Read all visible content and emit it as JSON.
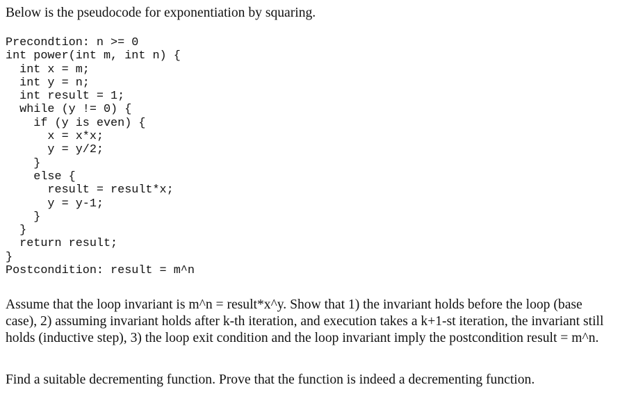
{
  "intro": "Below is the pseudocode for exponentiation by squaring.",
  "code_lines": [
    "Precondtion: n >= 0",
    "int power(int m, int n) {",
    "  int x = m;",
    "  int y = n;",
    "  int result = 1;",
    "  while (y != 0) {",
    "    if (y is even) {",
    "      x = x*x;",
    "      y = y/2;",
    "    }",
    "    else {",
    "      result = result*x;",
    "      y = y-1;",
    "    }",
    "  }",
    "  return result;",
    "}",
    "Postcondition: result = m^n"
  ],
  "assume_lines": [
    "Assume that the loop invariant is m^n = result*x^y. Show that 1) the invariant holds before the loop (base",
    "case), 2) assuming invariant holds after k-th iteration, and execution takes a k+1-st iteration, the invariant still",
    "holds (inductive step), 3) the loop exit condition and the loop invariant imply the postcondition result = m^n."
  ],
  "find": "Find a suitable decrementing function. Prove that the function is indeed a decrementing function."
}
